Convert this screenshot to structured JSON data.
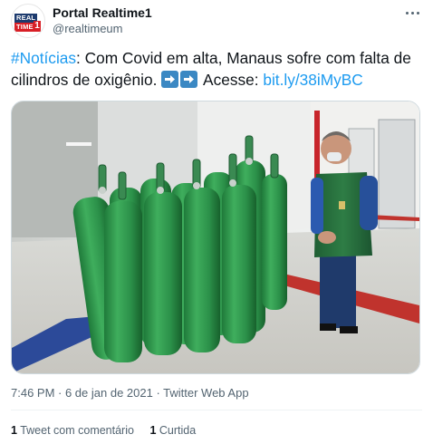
{
  "author": {
    "display_name": "Portal Realtime1",
    "handle": "@realtimeum",
    "avatar_logo_line1": "REAL",
    "avatar_logo_line2": "TIME",
    "avatar_logo_number": "1"
  },
  "tweet": {
    "hashtag": "#Notícias",
    "text_part1": ": Com Covid em alta, Manaus sofre com falta de cilindros de oxigênio. ",
    "emoji": [
      "right-arrow-icon",
      "right-arrow-icon"
    ],
    "text_part2": " Acesse: ",
    "link": "bit.ly/38iMyBC"
  },
  "media": {
    "description_icon": "photo-green-oxygen-cylinders"
  },
  "meta": {
    "timestamp": "7:46 PM · 6 de jan de 2021 · Twitter Web App"
  },
  "stats": {
    "quote_count": "1",
    "quote_label": "Tweet com comentário",
    "like_count": "1",
    "like_label": "Curtida"
  },
  "colors": {
    "link": "#1d9bf0",
    "secondary_text": "#536471",
    "cylinder_green": "#2f9a4c"
  }
}
